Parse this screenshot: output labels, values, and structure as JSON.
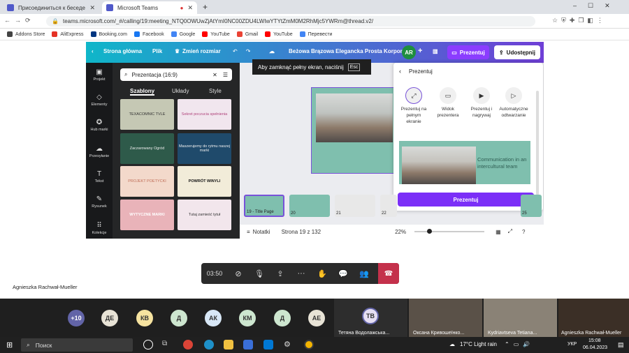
{
  "browser": {
    "tabs": [
      {
        "title": "Присоединиться к беседе"
      },
      {
        "title": "Microsoft Teams"
      }
    ],
    "url": "teams.microsoft.com/_#/calling/19:meeting_NTQ0OWUwZjAtYmI0NC00ZDU4LWIwYTYtZmM0M2RhMjc5YWRm@thread.v2/",
    "bookmarks": [
      "Addons Store",
      "AliExpress",
      "Booking.com",
      "Facebook",
      "Google",
      "YouTube",
      "Gmail",
      "YouTube",
      "Перевести"
    ]
  },
  "canva": {
    "home": "Strona główna",
    "file": "Plik",
    "resize": "Zmień rozmiar",
    "doc_title": "Beżowa Brązowa Elegancka Prosta Korpor...",
    "avatar": "AR",
    "present": "Prezentuj",
    "share": "Udostępnij",
    "sidebar": [
      "Projekt",
      "Elementy",
      "Hub marki",
      "Przesyłanie",
      "Tekst",
      "Rysunek",
      "Kolekcje"
    ],
    "search_value": "Prezentacja (16:9)",
    "panel_tabs": [
      "Szablony",
      "Układy",
      "Style"
    ],
    "templates": [
      "TEXACOMNIC TVLE",
      "Sekret poczucia spełnienia",
      "Zaczarowany Ogród",
      "Maszerujemy do rytmu naszej marki",
      "PROJEKT POETYCKI",
      "POWRÓT WINYLI",
      "WYTYCZNE MARKI",
      "Tutaj zamieść tytuł"
    ],
    "esc_text": "Aby zamknąć pełny ekran, naciśnij",
    "esc_key": "Esc",
    "present_panel": {
      "title": "Prezentuj",
      "options": [
        "Prezentuj na pełnym ekranie",
        "Widok prezentera",
        "Prezentuj i nagrywaj",
        "Automatyczne odtwarzanie"
      ],
      "preview_text": "Communication in an intercultural team",
      "button": "Prezentuj"
    },
    "strip": [
      "19 - Title Page",
      "20",
      "21",
      "22",
      "25"
    ],
    "notes": "Notatki",
    "page": "Strona 19 z 132",
    "zoom": "22%"
  },
  "call": {
    "timer": "03:50",
    "presenter": "Agnieszka Rachwał-Mueller"
  },
  "participants": {
    "more": "+10",
    "initials": [
      "ДЕ",
      "КВ",
      "Д",
      "АК",
      "КМ",
      "Д",
      "АЕ",
      "ТВ"
    ],
    "names": [
      "Тетяна Водолажська...",
      "Оксана Кривошеїнко...",
      "Kydriavtseva Tetiana...",
      "Agnieszka Rachwał-Mueller"
    ]
  },
  "taskbar": {
    "search": "Поиск",
    "weather": "17°C  Light rain",
    "lang": "УКР",
    "time": "15:08",
    "date": "06.04.2023"
  }
}
